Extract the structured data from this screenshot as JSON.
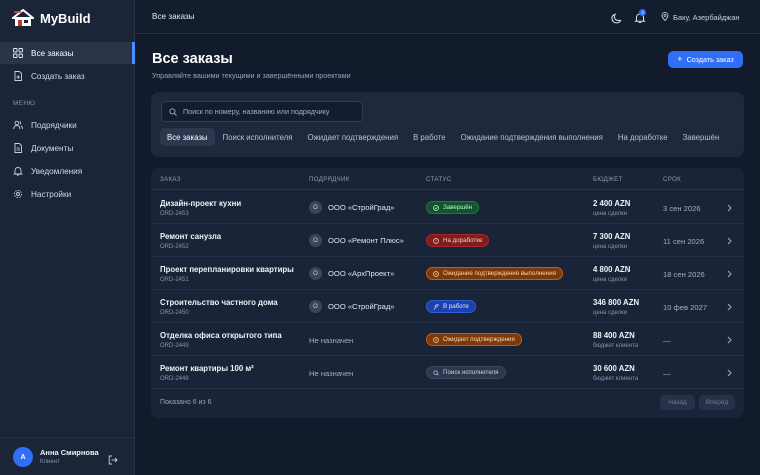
{
  "app": {
    "name": "MyBuild"
  },
  "sidebar": {
    "items": [
      {
        "label": "Все заказы",
        "icon": "grid-icon"
      },
      {
        "label": "Создать заказ",
        "icon": "file-plus-icon"
      }
    ],
    "section_label": "МЕНЮ",
    "menu": [
      {
        "label": "Подрядчики",
        "icon": "users-icon"
      },
      {
        "label": "Документы",
        "icon": "document-icon"
      },
      {
        "label": "Уведомления",
        "icon": "bell-icon"
      },
      {
        "label": "Настройки",
        "icon": "gear-icon"
      }
    ],
    "user": {
      "initial": "А",
      "name": "Анна Смирнова",
      "role": "Клиент"
    }
  },
  "header": {
    "title": "Все заказы",
    "notification_count": "3",
    "location": "Баку, Азербайджан"
  },
  "main": {
    "title": "Все заказы",
    "subtitle": "Управляйте вашими текущими и завершёнными проектами",
    "create_button": "Создать заказ",
    "search_placeholder": "Поиск по номеру, названию или подрядчику",
    "tabs": [
      "Все заказы",
      "Поиск исполнителя",
      "Ожидает подтверждения",
      "В работе",
      "Ожидание подтверждения выполнения",
      "На доработке",
      "Завершён"
    ],
    "active_tab": 0
  },
  "table": {
    "headers": {
      "order": "ЗАКАЗ",
      "contractor": "ПОДРЯДЧИК",
      "status": "СТАТУС",
      "budget": "БЮДЖЕТ",
      "deadline": "СРОК"
    },
    "rows": [
      {
        "title": "Дизайн-проект кухни",
        "id": "ORD-2453",
        "contractor_initial": "О",
        "contractor": "ООО «СтройГрад»",
        "status": "Завершён",
        "status_kind": "green",
        "budget": "2 400 AZN",
        "budget_note": "цена сделки",
        "deadline": "3 сен 2026"
      },
      {
        "title": "Ремонт санузла",
        "id": "ORD-2452",
        "contractor_initial": "О",
        "contractor": "ООО «Ремонт Плюс»",
        "status": "На доработке",
        "status_kind": "red",
        "budget": "7 300 AZN",
        "budget_note": "цена сделки",
        "deadline": "11 сен 2026"
      },
      {
        "title": "Проект перепланировки квартиры",
        "id": "ORD-2451",
        "contractor_initial": "О",
        "contractor": "ООО «АрхПроект»",
        "status": "Ожидание подтверждения выполнения",
        "status_kind": "orange",
        "budget": "4 800 AZN",
        "budget_note": "цена сделки",
        "deadline": "18 сен 2026"
      },
      {
        "title": "Строительство частного дома",
        "id": "ORD-2450",
        "contractor_initial": "О",
        "contractor": "ООО «СтройГрад»",
        "status": "В работе",
        "status_kind": "blue",
        "budget": "346 800 AZN",
        "budget_note": "цена сделки",
        "deadline": "10 фев 2027"
      },
      {
        "title": "Отделка офиса открытого типа",
        "id": "ORD-2449",
        "contractor_initial": "",
        "contractor": "Не назначен",
        "status": "Ожидает подтверждения",
        "status_kind": "orange",
        "budget": "88 400 AZN",
        "budget_note": "бюджет клиента",
        "deadline": "—"
      },
      {
        "title": "Ремонт квартиры 100 м²",
        "id": "ORD-2448",
        "contractor_initial": "",
        "contractor": "Не назначен",
        "status": "Поиск исполнителя",
        "status_kind": "gray",
        "budget": "30 600 AZN",
        "budget_note": "бюджет клиента",
        "deadline": "—"
      }
    ],
    "footer_text": "Показано 6 из 6",
    "prev_label": "Назад",
    "next_label": "Вперёд"
  }
}
